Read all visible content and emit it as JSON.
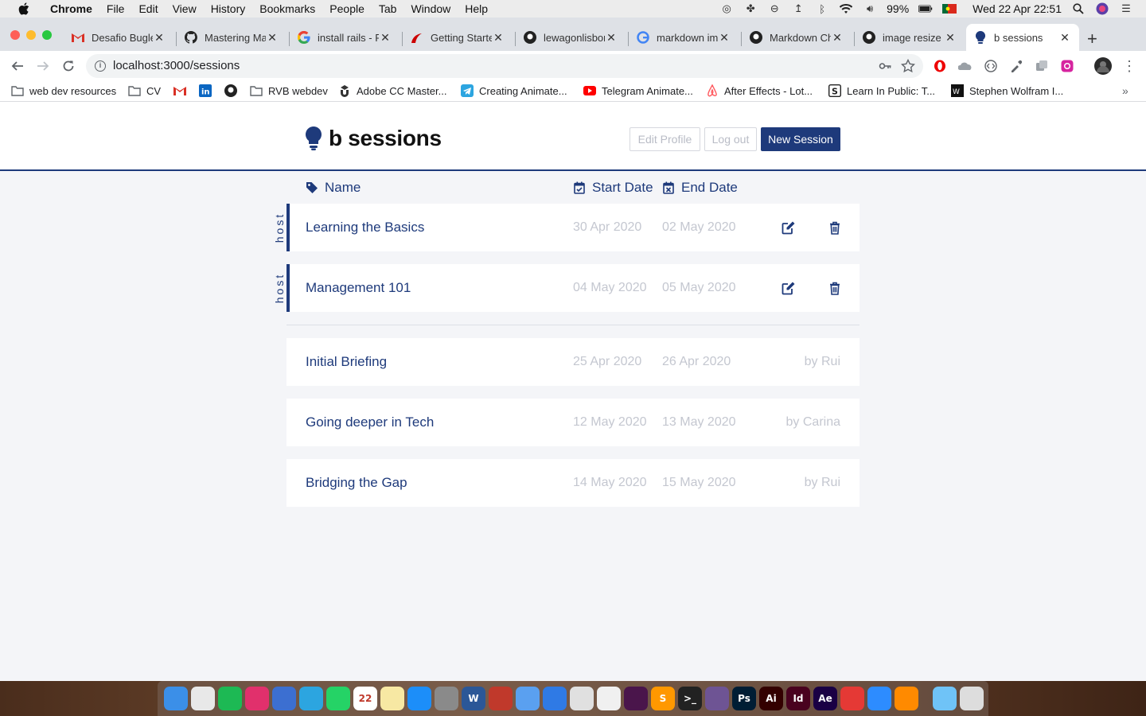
{
  "menubar": {
    "app_name": "Chrome",
    "items": [
      "File",
      "Edit",
      "View",
      "History",
      "Bookmarks",
      "People",
      "Tab",
      "Window",
      "Help"
    ],
    "battery": "99%",
    "datetime": "Wed 22 Apr  22:51"
  },
  "tabs": [
    {
      "title": "Desafio Bugle",
      "icon": "gmail-icon"
    },
    {
      "title": "Mastering Ma",
      "icon": "github-icon"
    },
    {
      "title": "install rails - F",
      "icon": "google-icon"
    },
    {
      "title": "Getting Starte",
      "icon": "rails-icon"
    },
    {
      "title": "lewagonlisbon",
      "icon": "github-icon"
    },
    {
      "title": "markdown ima",
      "icon": "google-icon"
    },
    {
      "title": "Markdown Ch",
      "icon": "github-icon"
    },
    {
      "title": "image resize i",
      "icon": "github-icon"
    },
    {
      "title": "b sessions",
      "icon": "bulb-icon",
      "active": true
    }
  ],
  "address_bar": {
    "url": "localhost:3000/sessions"
  },
  "bookmarks": [
    {
      "label": "web dev resources",
      "icon": "folder-icon"
    },
    {
      "label": "CV",
      "icon": "folder-icon"
    },
    {
      "label": "",
      "icon": "gmail-icon"
    },
    {
      "label": "",
      "icon": "linkedin-icon"
    },
    {
      "label": "",
      "icon": "github-icon"
    },
    {
      "label": "RVB webdev",
      "icon": "folder-icon"
    },
    {
      "label": "Adobe CC Master...",
      "icon": "udemy-icon"
    },
    {
      "label": "Creating Animate...",
      "icon": "telegram-icon"
    },
    {
      "label": "Telegram Animate...",
      "icon": "youtube-icon"
    },
    {
      "label": "After Effects - Lot...",
      "icon": "airbnb-icon"
    },
    {
      "label": "Learn In Public: T...",
      "icon": "s-icon"
    },
    {
      "label": "Stephen Wolfram I...",
      "icon": "wolfram-icon"
    }
  ],
  "app": {
    "brand": "b sessions",
    "buttons": {
      "edit_profile": "Edit Profile",
      "log_out": "Log out",
      "new_session": "New Session"
    },
    "columns": {
      "name": "Name",
      "start": "Start Date",
      "end": "End Date"
    },
    "host_label": "host",
    "hosted_sessions": [
      {
        "name": "Learning the Basics",
        "start": "30 Apr 2020",
        "end": "02 May 2020"
      },
      {
        "name": "Management 101",
        "start": "04 May 2020",
        "end": "05 May 2020"
      }
    ],
    "other_sessions": [
      {
        "name": "Initial Briefing",
        "start": "25 Apr 2020",
        "end": "26 Apr 2020",
        "by": "by Rui"
      },
      {
        "name": "Going deeper in Tech",
        "start": "12 May 2020",
        "end": "13 May 2020",
        "by": "by Carina"
      },
      {
        "name": "Bridging the Gap",
        "start": "14 May 2020",
        "end": "15 May 2020",
        "by": "by Rui"
      }
    ]
  },
  "colors": {
    "primary": "#1e3a7b",
    "muted": "#c4c7d0",
    "page_bg": "#f4f5f8"
  },
  "dock": [
    {
      "label": "",
      "color": "#3b8fe8"
    },
    {
      "label": "",
      "color": "#e8e8e8"
    },
    {
      "label": "",
      "color": "#1db954"
    },
    {
      "label": "",
      "color": "#e1306c"
    },
    {
      "label": "",
      "color": "#3c6fd1"
    },
    {
      "label": "",
      "color": "#2ca5e0"
    },
    {
      "label": "",
      "color": "#25d366"
    },
    {
      "label": "22",
      "color": "#ffffff"
    },
    {
      "label": "",
      "color": "#f7e8a3"
    },
    {
      "label": "",
      "color": "#1c8ef9"
    },
    {
      "label": "",
      "color": "#8a8a8a"
    },
    {
      "label": "W",
      "color": "#2b5797"
    },
    {
      "label": "",
      "color": "#c0392b"
    },
    {
      "label": "",
      "color": "#5aa0f0"
    },
    {
      "label": "",
      "color": "#2f7ae5"
    },
    {
      "label": "",
      "color": "#e0e0e0"
    },
    {
      "label": "",
      "color": "#f0f0f0"
    },
    {
      "label": "",
      "color": "#4a154b"
    },
    {
      "label": "S",
      "color": "#ff9800"
    },
    {
      "label": ">_",
      "color": "#222222"
    },
    {
      "label": "",
      "color": "#6e5494"
    },
    {
      "label": "Ps",
      "color": "#001d34"
    },
    {
      "label": "Ai",
      "color": "#330000"
    },
    {
      "label": "Id",
      "color": "#49021f"
    },
    {
      "label": "Ae",
      "color": "#1a0044"
    },
    {
      "label": "",
      "color": "#e53935"
    },
    {
      "label": "",
      "color": "#2d8cff"
    },
    {
      "label": "",
      "color": "#ff8a00"
    },
    {
      "label": "",
      "color": "#6fc3f7"
    },
    {
      "label": "",
      "color": "#dddddd"
    }
  ]
}
